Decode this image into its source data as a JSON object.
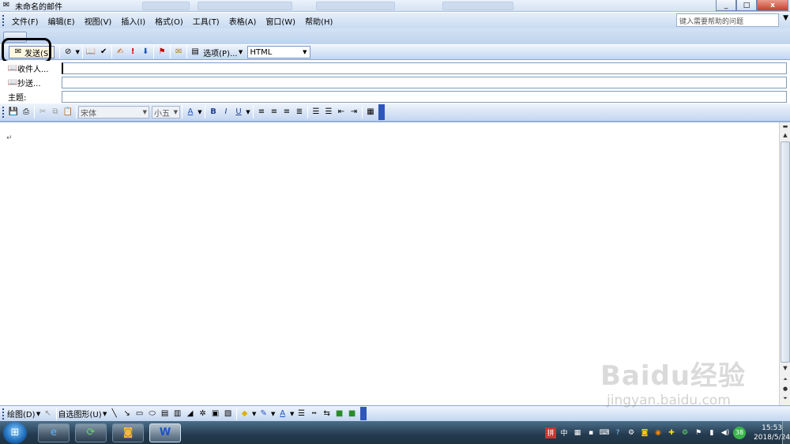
{
  "window": {
    "title": "未命名的邮件",
    "min": "_",
    "max": "□",
    "close": "x"
  },
  "menu": {
    "items": [
      "文件(F)",
      "编辑(E)",
      "视图(V)",
      "插入(I)",
      "格式(O)",
      "工具(T)",
      "表格(A)",
      "窗口(W)",
      "帮助(H)"
    ],
    "help_placeholder": "键入需要帮助的问题"
  },
  "toolbar": {
    "send_label": "发送(S)",
    "options_label": "选项(P)...",
    "format_value": "HTML"
  },
  "address": {
    "to_label": "收件人...",
    "cc_label": "抄送...",
    "subject_label": "主题:"
  },
  "formatting": {
    "font": "宋体",
    "size": "小五"
  },
  "body": {
    "mark": "↵"
  },
  "drawing": {
    "draw_label": "绘图(D)",
    "autoshape_label": "自选图形(U)"
  },
  "taskbar": {
    "tray_lang": "中",
    "tray_badge": "38",
    "time": "15:53",
    "date": "2018/5/24"
  },
  "watermark": {
    "brand": "Baidu经验",
    "url": "jingyan.baidu.com"
  },
  "colors": {
    "toolbar_blue": "#c3d6f0",
    "accent": "#2e57b9",
    "highlight_ring": "#000000"
  }
}
